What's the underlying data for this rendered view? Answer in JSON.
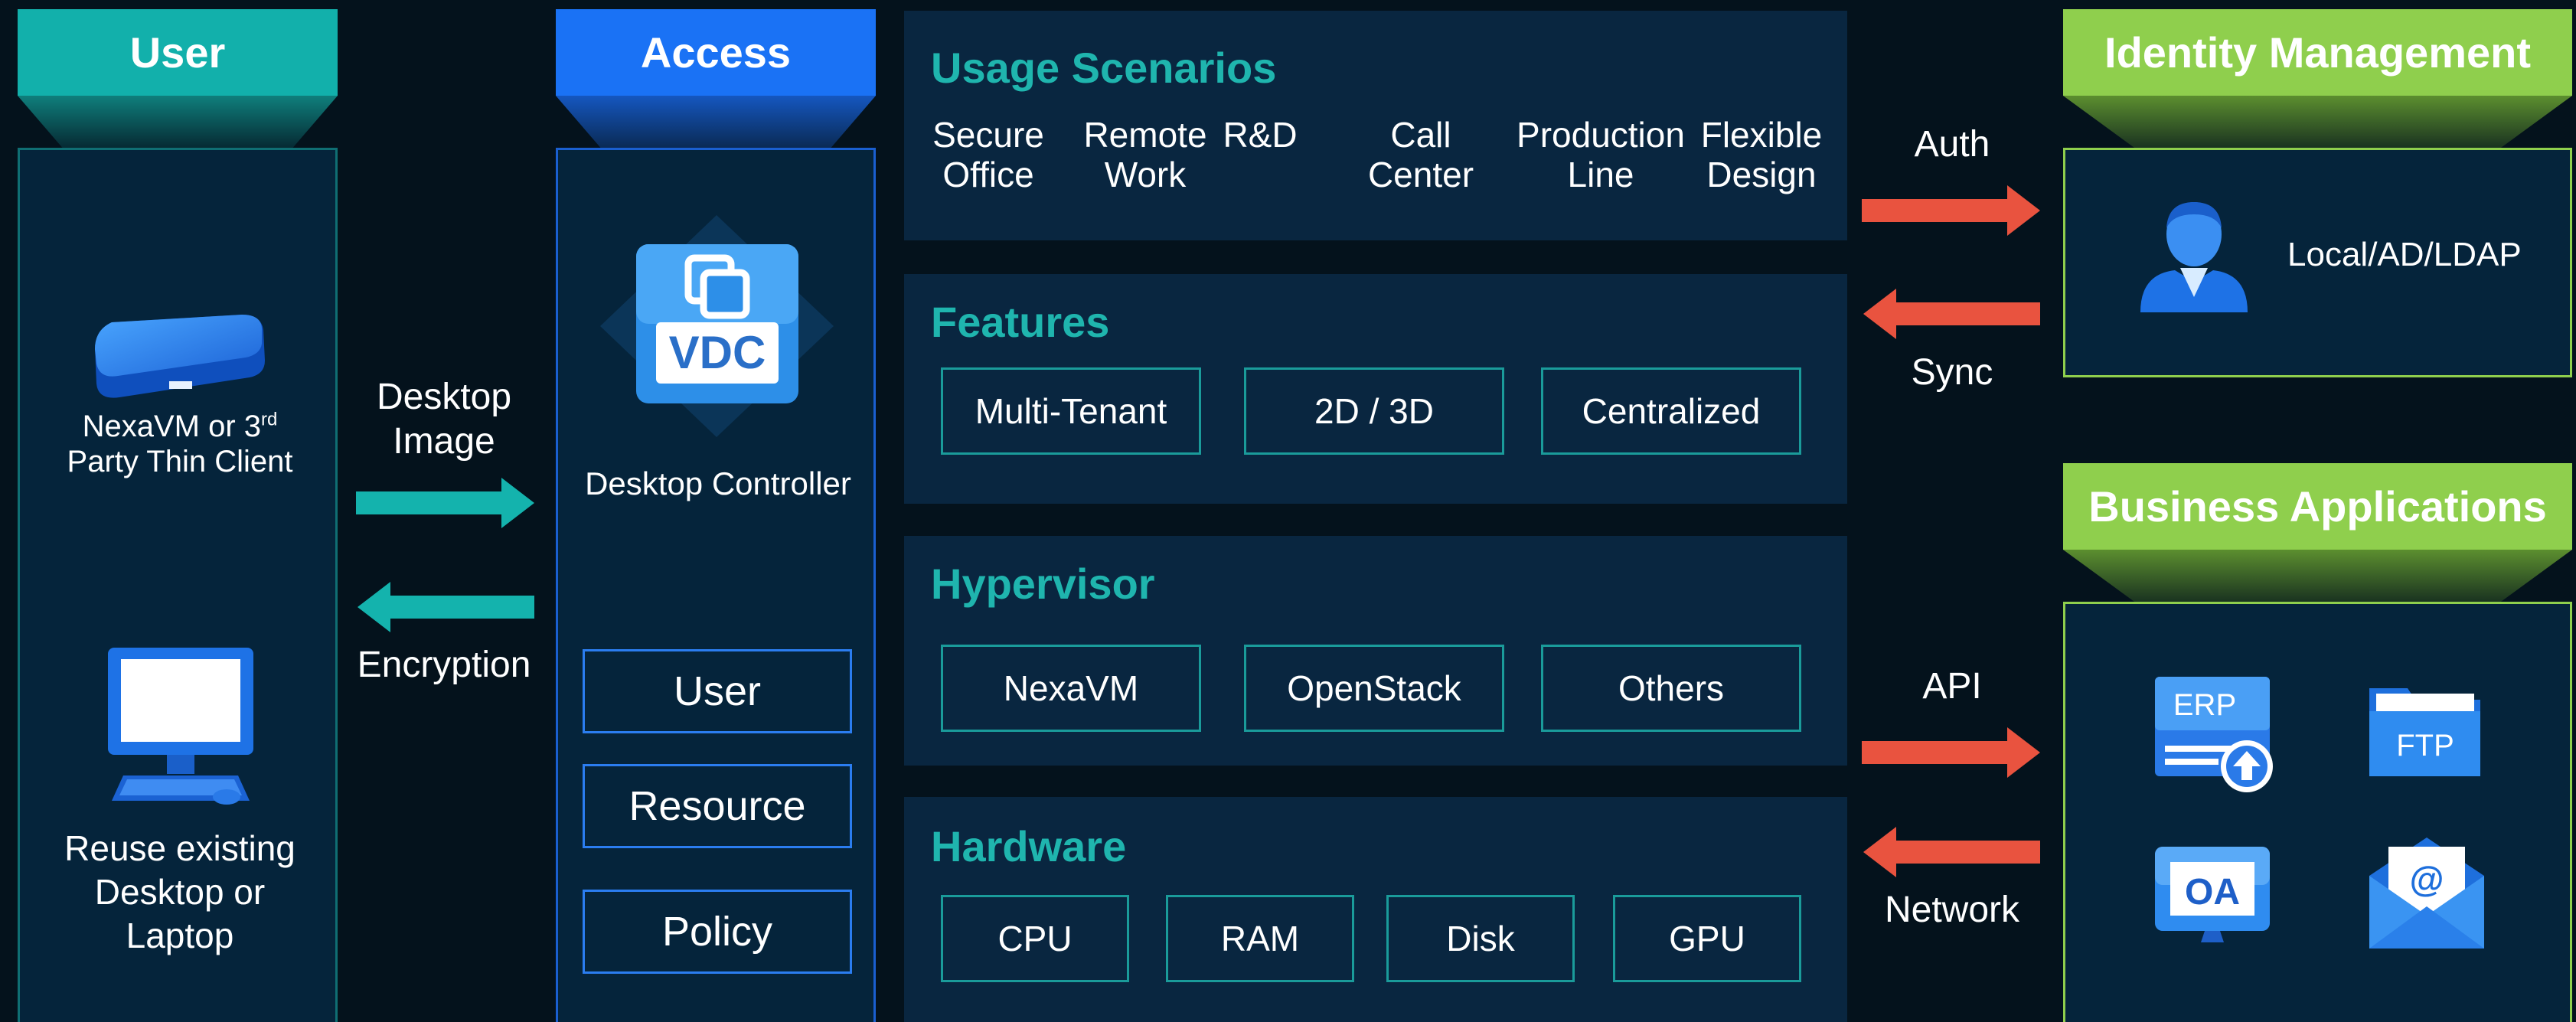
{
  "columns": {
    "user": {
      "title": "User"
    },
    "access": {
      "title": "Access"
    },
    "identity": {
      "title": "Identity Management"
    },
    "business": {
      "title": "Business Applications"
    }
  },
  "user": {
    "thin_client_label_line1_prefix": "NexaVM or 3",
    "thin_client_label_line1_sup": "rd",
    "thin_client_label_line2": "Party Thin Client",
    "desktop_label_line1": "Reuse existing",
    "desktop_label_line2": "Desktop or",
    "desktop_label_line3": "Laptop"
  },
  "links_user_access": {
    "top_line1": "Desktop",
    "top_line2": "Image",
    "bottom": "Encryption"
  },
  "access": {
    "logo_text": "VDC",
    "controller_label": "Desktop Controller",
    "boxes": [
      "User",
      "Resource",
      "Policy"
    ]
  },
  "usage": {
    "title": "Usage Scenarios",
    "items": [
      {
        "line1": "Secure",
        "line2": "Office"
      },
      {
        "line1": "Remote",
        "line2": "Work"
      },
      {
        "line1": "R&D",
        "line2": ""
      },
      {
        "line1": "Call",
        "line2": "Center"
      },
      {
        "line1": "Production",
        "line2": "Line"
      },
      {
        "line1": "Flexible",
        "line2": "Design"
      }
    ]
  },
  "features": {
    "title": "Features",
    "boxes": [
      "Multi-Tenant",
      "2D / 3D",
      "Centralized"
    ]
  },
  "hypervisor": {
    "title": "Hypervisor",
    "boxes": [
      "NexaVM",
      "OpenStack",
      "Others"
    ]
  },
  "hardware": {
    "title": "Hardware",
    "boxes": [
      "CPU",
      "RAM",
      "Disk",
      "GPU"
    ]
  },
  "links_identity": {
    "top": "Auth",
    "bottom": "Sync"
  },
  "links_business": {
    "top": "API",
    "bottom": "Network"
  },
  "identity": {
    "label": "Local/AD/LDAP"
  },
  "business": {
    "apps": [
      "ERP",
      "FTP",
      "OA",
      "@"
    ]
  },
  "colors": {
    "teal": "#14b3ad",
    "blue": "#1a72f5",
    "green": "#8fcf4d",
    "red_arrow": "#e9533f",
    "background": "#04121c"
  }
}
